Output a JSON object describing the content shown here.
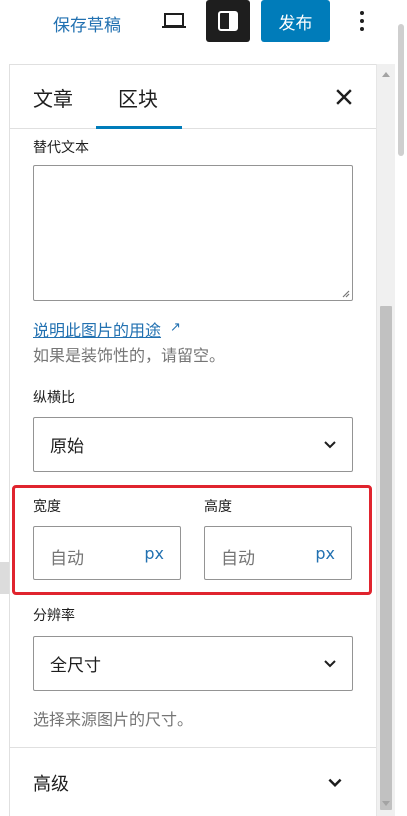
{
  "toolbar": {
    "save_draft": "保存草稿",
    "publish": "发布",
    "icons": [
      "preview-icon",
      "settings-sidebar-icon",
      "more-options-icon"
    ]
  },
  "panel": {
    "tabs": [
      {
        "label": "文章"
      },
      {
        "label": "区块",
        "active": true
      }
    ],
    "alt_text": {
      "label": "替代文本",
      "value": "",
      "link": "说明此图片的用途",
      "help": "如果是装饰性的，请留空。"
    },
    "aspect_ratio": {
      "label": "纵横比",
      "value": "原始"
    },
    "dimensions": {
      "width_label": "宽度",
      "height_label": "高度",
      "width_placeholder": "自动",
      "height_placeholder": "自动",
      "unit": "px"
    },
    "resolution": {
      "label": "分辨率",
      "value": "全尺寸",
      "help": "选择来源图片的尺寸。"
    },
    "advanced": {
      "title": "高级"
    }
  },
  "colors": {
    "accent": "#007cba",
    "link": "#2271b1",
    "highlight": "#e0242e"
  }
}
